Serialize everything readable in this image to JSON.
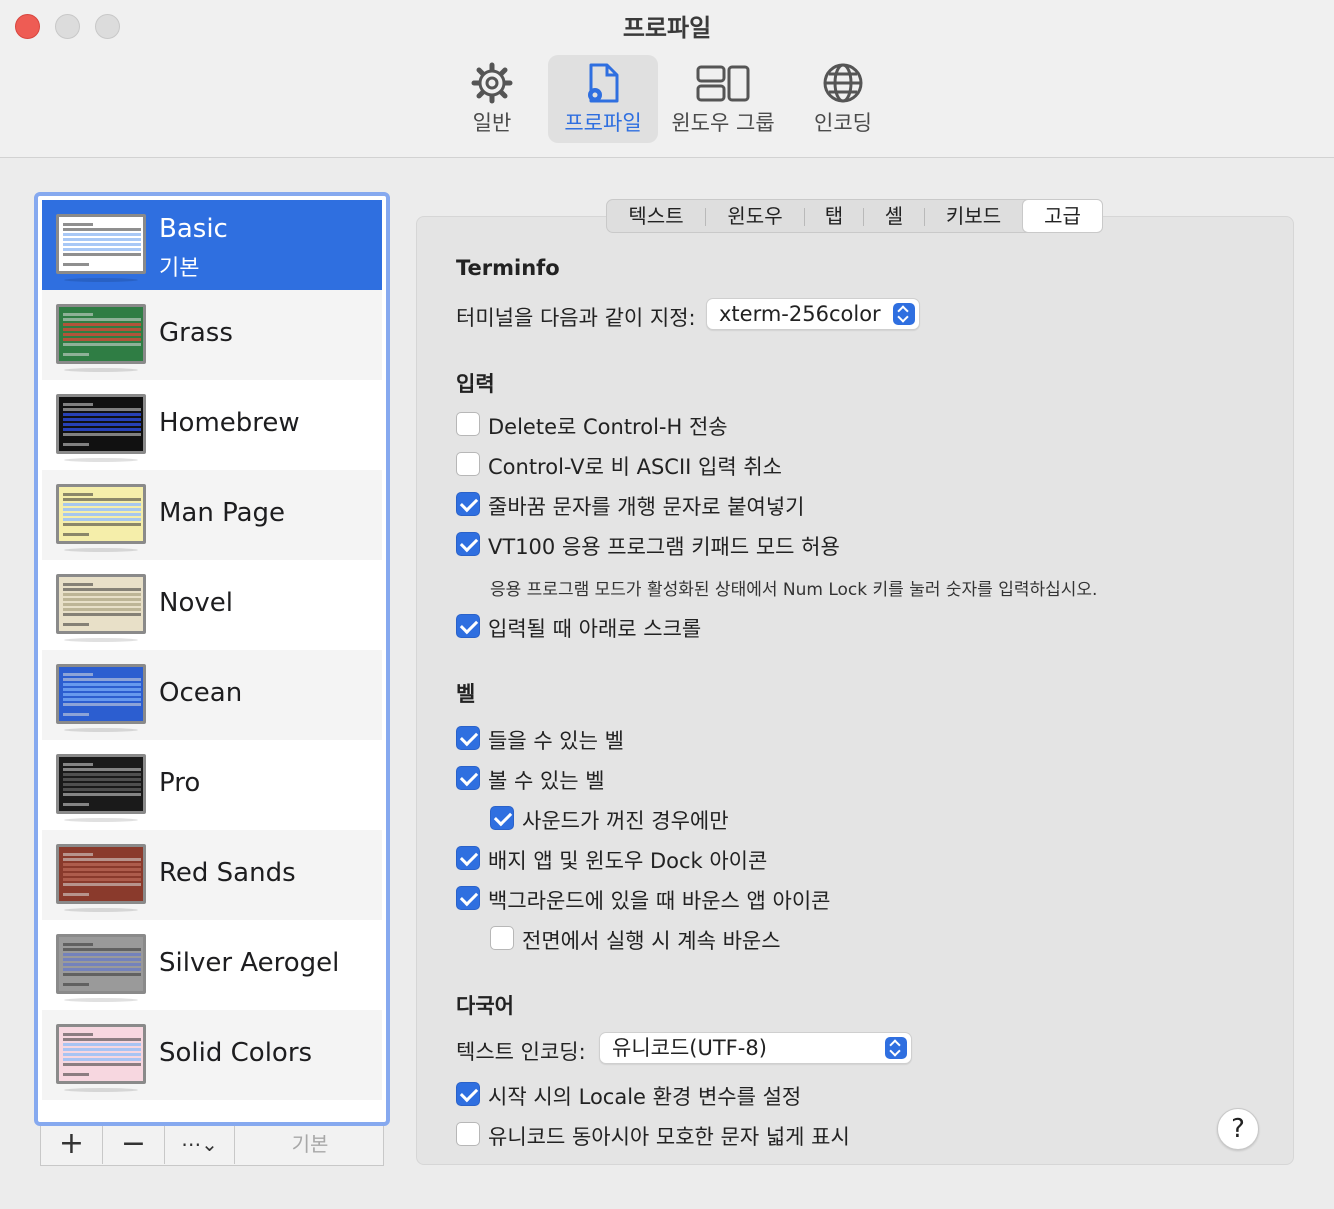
{
  "window": {
    "title": "프로파일",
    "toolbar": [
      {
        "label": "일반",
        "icon": "gear-icon"
      },
      {
        "label": "프로파일",
        "icon": "profile-doc-icon",
        "active": true
      },
      {
        "label": "윈도우 그룹",
        "icon": "window-group-icon"
      },
      {
        "label": "인코딩",
        "icon": "globe-icon"
      }
    ]
  },
  "profiles": [
    {
      "name": "Basic",
      "subtitle": "기본",
      "selected": true,
      "bg": "#ffffff",
      "hl": "#9ec2f5"
    },
    {
      "name": "Grass",
      "bg": "#2f7d44",
      "hl": "#c0503a"
    },
    {
      "name": "Homebrew",
      "bg": "#111111",
      "hl": "#2a47c8"
    },
    {
      "name": "Man Page",
      "bg": "#f5eeaa",
      "hl": "#9ec2f5"
    },
    {
      "name": "Novel",
      "bg": "#e8e0c8",
      "hl": "#b8b090"
    },
    {
      "name": "Ocean",
      "bg": "#2c5ed0",
      "hl": "#6ea0f0"
    },
    {
      "name": "Pro",
      "bg": "#1a1a1a",
      "hl": "#555555"
    },
    {
      "name": "Red Sands",
      "bg": "#8a3a2c",
      "hl": "#b06050"
    },
    {
      "name": "Silver Aerogel",
      "bg": "#9a9a9a",
      "hl": "#7080c0"
    },
    {
      "name": "Solid Colors",
      "bg": "#f7d7e0",
      "hl": "#9ec2f5"
    }
  ],
  "list_buttons": {
    "add": "+",
    "remove": "−",
    "more": "⋯⌄",
    "default": "기본"
  },
  "tabs": [
    "텍스트",
    "윈도우",
    "탭",
    "셸",
    "키보드",
    "고급"
  ],
  "active_tab": "고급",
  "terminfo": {
    "heading": "Terminfo",
    "label": "터미널을 다음과 같이 지정:",
    "value": "xterm-256color"
  },
  "input": {
    "heading": "입력",
    "options": [
      {
        "label": "Delete로 Control-H 전송",
        "checked": false
      },
      {
        "label": "Control-V로 비 ASCII 입력 취소",
        "checked": false
      },
      {
        "label": "줄바꿈 문자를 개행 문자로 붙여넣기",
        "checked": true
      },
      {
        "label": "VT100 응용 프로그램 키패드 모드 허용",
        "checked": true
      }
    ],
    "note": "응용 프로그램 모드가 활성화된 상태에서 Num Lock 키를 눌러 숫자를 입력하십시오.",
    "scroll": {
      "label": "입력될 때 아래로 스크롤",
      "checked": true
    }
  },
  "bell": {
    "heading": "벨",
    "options": [
      {
        "label": "들을 수 있는 벨",
        "checked": true
      },
      {
        "label": "볼 수 있는 벨",
        "checked": true
      },
      {
        "label": "사운드가 꺼진 경우에만",
        "checked": true
      },
      {
        "label": "배지 앱 및 윈도우 Dock 아이콘",
        "checked": true
      },
      {
        "label": "백그라운드에 있을 때 바운스 앱 아이콘",
        "checked": true
      },
      {
        "label": "전면에서 실행 시 계속 바운스",
        "checked": false
      }
    ]
  },
  "multilang": {
    "heading": "다국어",
    "encoding_label": "텍스트 인코딩:",
    "encoding_value": "유니코드(UTF-8)",
    "options": [
      {
        "label": "시작 시의 Locale 환경 변수를 설정",
        "checked": true
      },
      {
        "label": "유니코드 동아시아 모호한 문자 넓게 표시",
        "checked": false
      }
    ]
  },
  "help": "?"
}
